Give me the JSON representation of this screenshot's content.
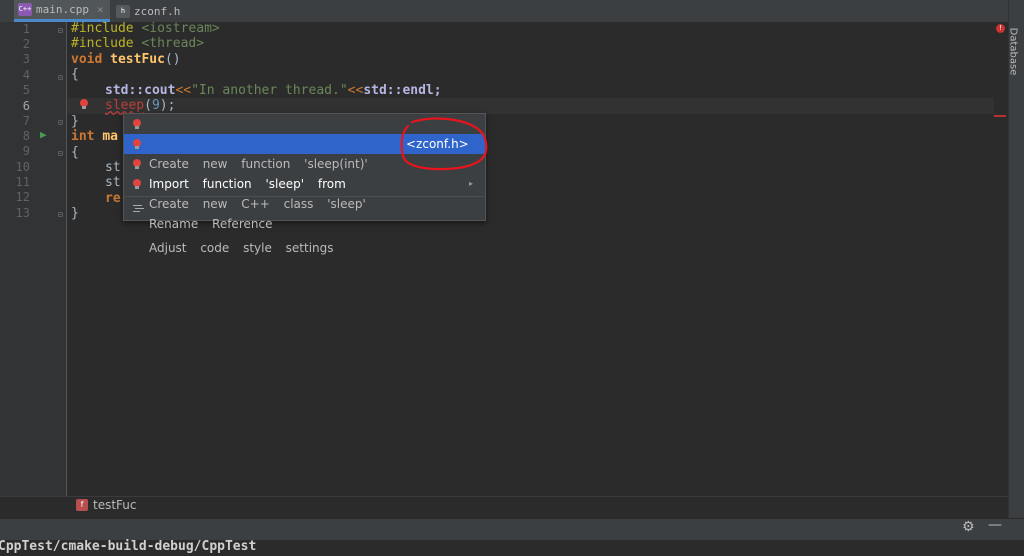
{
  "tabs": [
    {
      "label": "main.cpp",
      "icon": "cpp-file-icon",
      "active": true,
      "close": "×"
    },
    {
      "label": "zconf.h",
      "icon": "header-file-icon",
      "active": false,
      "close": ""
    }
  ],
  "right_panel": {
    "label": "Database"
  },
  "gutter": {
    "line_numbers": [
      "1",
      "2",
      "3",
      "4",
      "5",
      "6",
      "7",
      "8",
      "9",
      "10",
      "11",
      "12",
      "13"
    ]
  },
  "code": {
    "line1": [
      "#include ",
      "<iostream>"
    ],
    "line2": [
      "#include ",
      "<thread>"
    ],
    "line3": [
      "void ",
      "testFuc",
      "()"
    ],
    "line4": "{",
    "line5": [
      "std::cout",
      "<<",
      "\"In another thread.\"",
      "<<",
      "std::endl;"
    ],
    "line6": [
      "sleep",
      "(",
      "9",
      ");"
    ],
    "line7": "}",
    "line8": [
      "int ",
      "ma"
    ],
    "line9": "{",
    "line10": "st",
    "line11": "st",
    "line12": "re",
    "line13": "}"
  },
  "intention_popup": {
    "items": [
      {
        "label": "Create new function 'sleep(int)'",
        "selected": false,
        "icon": "red-bulb-icon"
      },
      {
        "label": "Import function 'sleep' from",
        "selected": true,
        "icon": "red-bulb-icon"
      },
      {
        "label": "Create new C++ class 'sleep'",
        "selected": false,
        "icon": "red-bulb-icon"
      },
      {
        "label": "Rename Reference",
        "selected": false,
        "icon": "red-bulb-icon",
        "submenu": "▸"
      },
      {
        "label": "Adjust code style settings",
        "selected": false,
        "icon": "settings-lines-icon"
      }
    ],
    "import_source": "<zconf.h>"
  },
  "breadcrumb": {
    "label": "testFuc",
    "icon_letter": "f"
  },
  "toolbar": {
    "gear": "⚙",
    "minimize": "—"
  },
  "run_path": "CppTest/cmake-build-debug/CppTest",
  "error_marker": "!",
  "colors": {
    "background": "#2b2b2b",
    "selection": "#2f65ca",
    "keyword": "#cc7832",
    "string": "#6a8759",
    "function": "#ffc66d",
    "number": "#6897bb",
    "annotation": "#e8141d"
  }
}
